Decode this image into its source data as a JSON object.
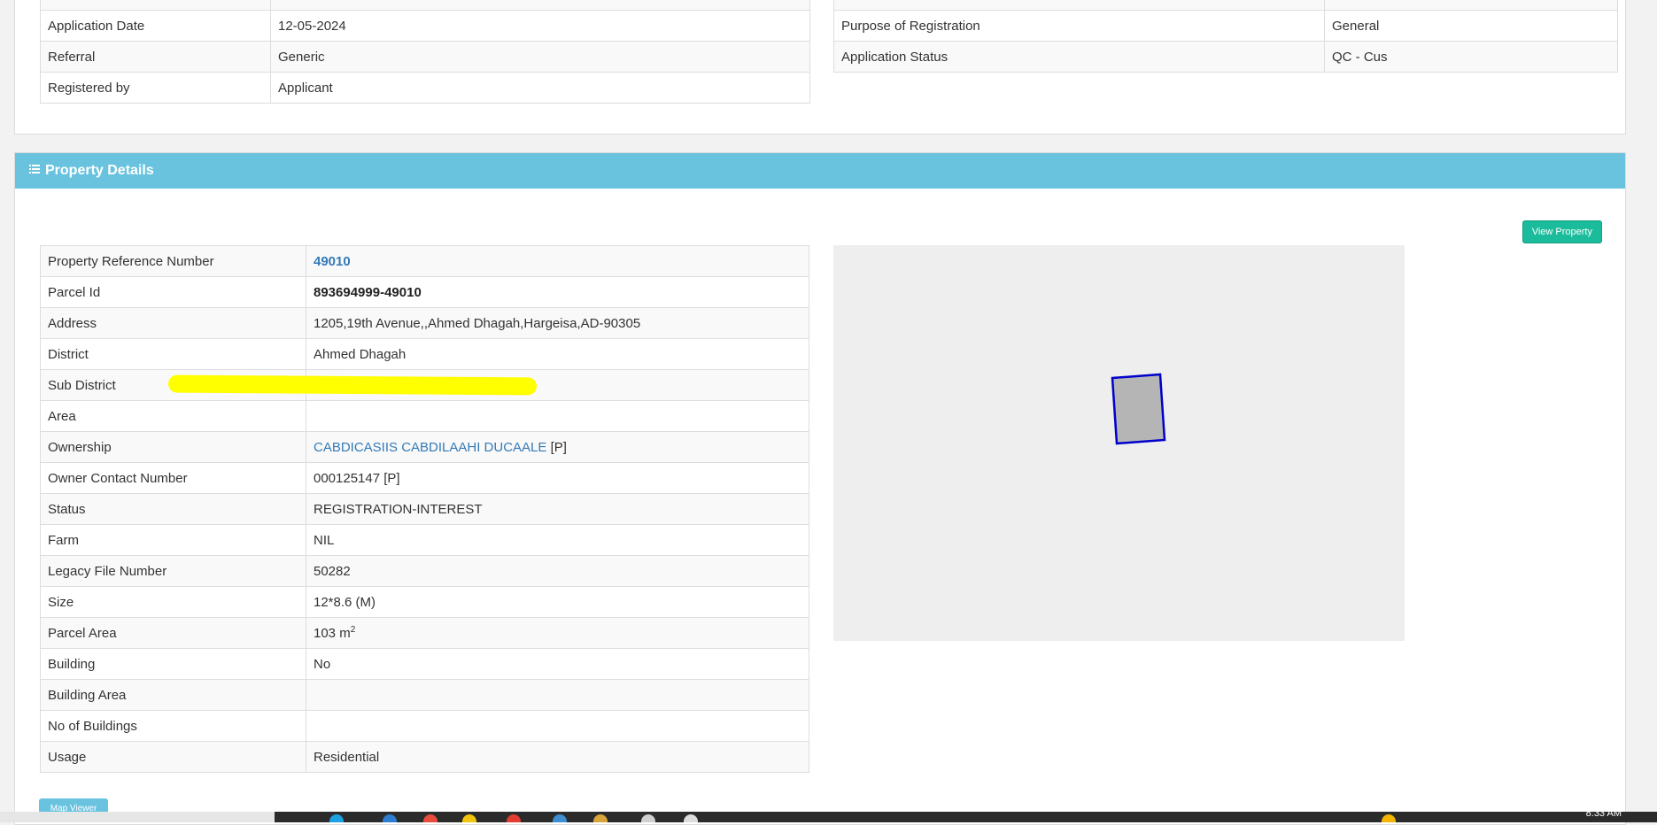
{
  "application": {
    "left_rows": [
      {
        "label": "Application Date",
        "value": "12-05-2024"
      },
      {
        "label": "Referral",
        "value": "Generic"
      },
      {
        "label": "Registered by",
        "value": "Applicant"
      }
    ],
    "right_rows": [
      {
        "label": "Purpose of Registration",
        "value": "General"
      },
      {
        "label": "Application Status",
        "value": "QC - Cus"
      }
    ]
  },
  "property": {
    "heading": "Property Details",
    "view_button": "View Property",
    "map_button": "Map Viewer",
    "rows": [
      {
        "label": "Property Reference Number",
        "value": "49010"
      },
      {
        "label": "Parcel Id",
        "value": "893694999-49010"
      },
      {
        "label": "Address",
        "value": "1205,19th Avenue,,Ahmed Dhagah,Hargeisa,AD-90305"
      },
      {
        "label": "District",
        "value": "Ahmed Dhagah"
      },
      {
        "label": "Sub District",
        "value": ""
      },
      {
        "label": "Area",
        "value": ""
      },
      {
        "label": "Ownership",
        "value": "CABDICASIIS CABDILAAHI DUCAALE",
        "suffix": "[P]"
      },
      {
        "label": "Owner Contact Number",
        "value": "000125147 [P]"
      },
      {
        "label": "Status",
        "value": "REGISTRATION-INTEREST"
      },
      {
        "label": "Farm",
        "value": "NIL"
      },
      {
        "label": "Legacy File Number",
        "value": "50282"
      },
      {
        "label": "Size",
        "value": "12*8.6 (M)"
      },
      {
        "label": "Parcel Area",
        "value": "103 m",
        "sup": "2"
      },
      {
        "label": "Building",
        "value": "No"
      },
      {
        "label": "Building Area",
        "value": ""
      },
      {
        "label": "No of Buildings",
        "value": ""
      },
      {
        "label": "Usage",
        "value": "Residential"
      }
    ]
  },
  "taskbar": {
    "clock": "8:33 AM"
  },
  "colors": {
    "heading": "#69c3df",
    "button": "#1abc9c",
    "link": "#337ab7",
    "parcel_stroke": "#0000cc",
    "parcel_fill": "#b5b5b5"
  }
}
